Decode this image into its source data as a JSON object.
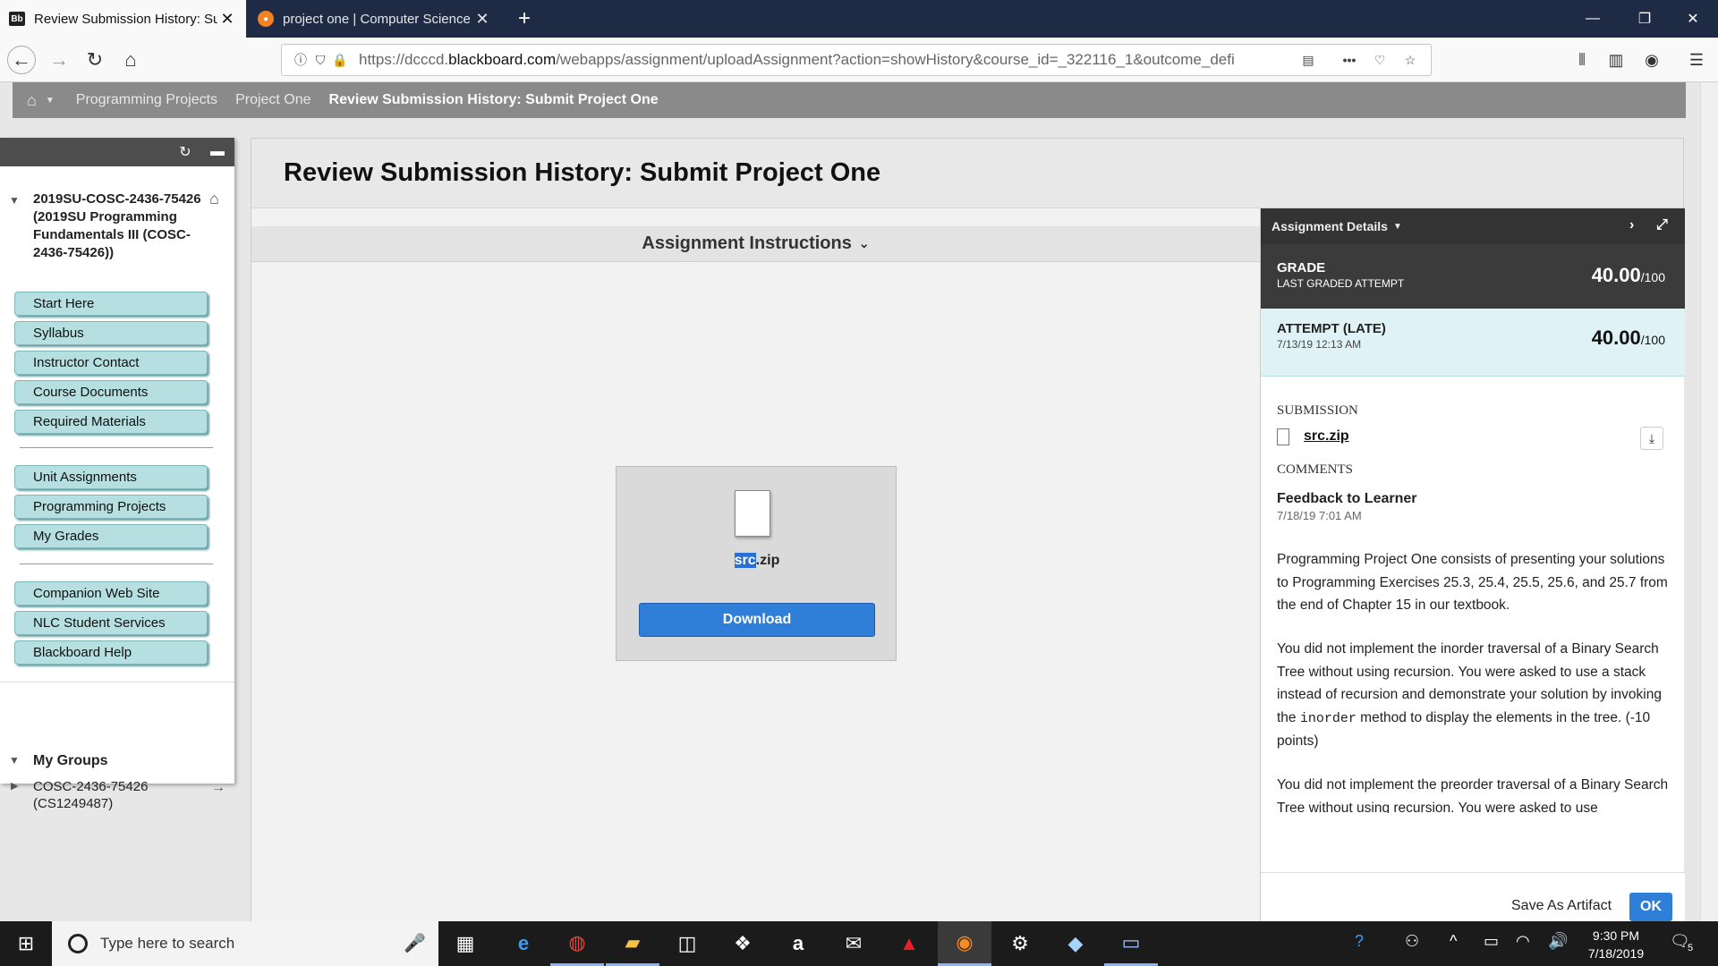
{
  "browser": {
    "tabs": [
      {
        "favicon": "Bb",
        "title": "Review Submission History: Sub",
        "active": true
      },
      {
        "favicon": "stackexchange-icon",
        "title": "project one | Computer Science",
        "active": false
      }
    ],
    "new_tab": "+",
    "url": {
      "prefix": "https://dcccd.",
      "domain": "blackboard.com",
      "path": "/webapps/assignment/uploadAssignment?action=showHistory&course_id=_322116_1&outcome_defi"
    },
    "window_controls": [
      "—",
      "❐",
      "✕"
    ]
  },
  "breadcrumbs": [
    "Programming Projects",
    "Project One",
    "Review Submission History: Submit Project One"
  ],
  "course_menu": {
    "course_title": "2019SU-COSC-2436-75426 (2019SU Programming Fundamentals III (COSC-2436-75426))",
    "group1": [
      "Start Here",
      "Syllabus",
      "Instructor Contact",
      "Course Documents",
      "Required Materials"
    ],
    "group2": [
      "Unit Assignments",
      "Programming Projects",
      "My Grades"
    ],
    "group3": [
      "Companion Web Site",
      "NLC Student Services",
      "Blackboard Help"
    ],
    "my_groups_label": "My Groups",
    "group_item": "COSC-2436-75426 (CS1249487)"
  },
  "main": {
    "title": "Review Submission History: Submit Project One",
    "instructions_label": "Assignment Instructions",
    "file": {
      "name_highlight": "src",
      "name_rest": ".zip"
    },
    "download_label": "Download"
  },
  "details": {
    "header": "Assignment Details",
    "grade_label": "GRADE",
    "grade_sub": "LAST GRADED ATTEMPT",
    "grade_score": "40.00",
    "grade_max": "/100",
    "attempt_label": "ATTEMPT (LATE)",
    "attempt_date": "7/13/19 12:13 AM",
    "attempt_score": "40.00",
    "attempt_max": "/100",
    "submission_label": "SUBMISSION",
    "submission_file": "src.zip",
    "comments_label": "COMMENTS",
    "feedback_title": "Feedback to Learner",
    "feedback_date": "7/18/19 7:01 AM",
    "para1": "Programming Project One consists of presenting your solutions to Programming Exercises 25.3, 25.4, 25.5, 25.6, and 25.7 from the end of Chapter 15 in our textbook.",
    "para2_a": "You did not implement the inorder traversal of a Binary Search Tree without using recursion. You were asked to use a stack instead of recursion and demonstrate your solution by invoking the ",
    "para2_code": "inorder",
    "para2_b": " method to display the elements in the tree. (-10 points)",
    "para3": "You did not implement the preorder traversal of a Binary Search Tree without using recursion. You were asked to use",
    "save_artifact": "Save As Artifact",
    "ok": "OK"
  },
  "taskbar": {
    "search_placeholder": "Type here to search",
    "time": "9:30 PM",
    "date": "7/18/2019",
    "notification_count": "5"
  },
  "colors": {
    "menu_button": "#b5dfe0",
    "accent_blue": "#2f7fd8",
    "tab_strip": "#1f2a44"
  }
}
